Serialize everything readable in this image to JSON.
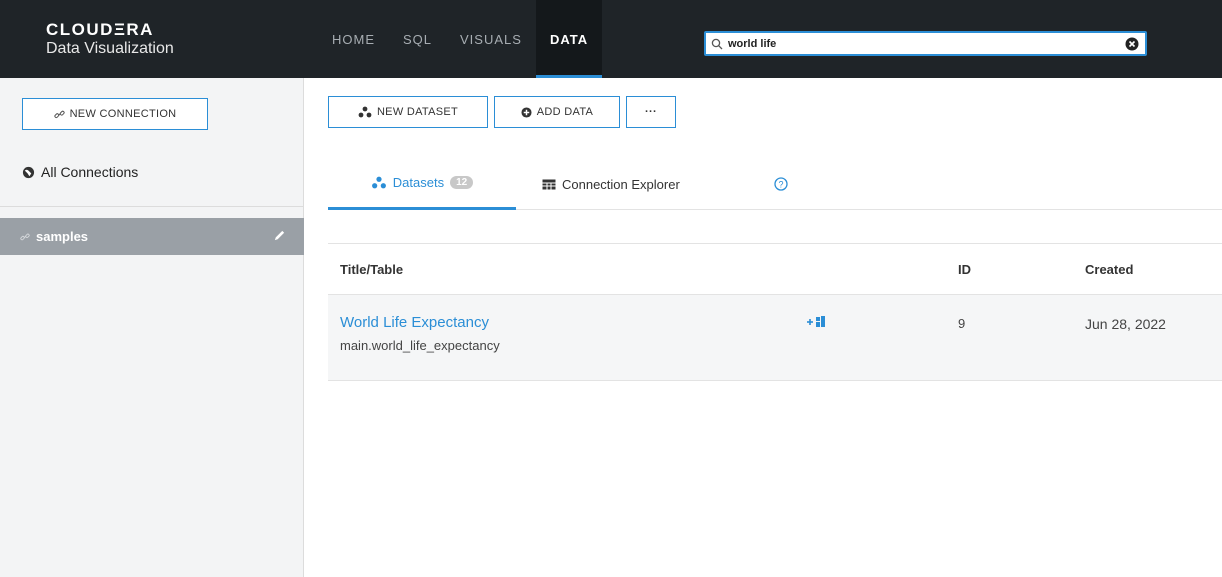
{
  "brand": {
    "name": "CLOUDΞRA",
    "product": "Data Visualization"
  },
  "nav": {
    "items": [
      "HOME",
      "SQL",
      "VISUALS",
      "DATA"
    ],
    "active": "DATA"
  },
  "search": {
    "value": "world life",
    "placeholder": ""
  },
  "sidebar": {
    "new_connection_label": "NEW CONNECTION",
    "all_connections_label": "All Connections",
    "connections": [
      {
        "label": "samples",
        "selected": true
      }
    ]
  },
  "toolbar": {
    "new_dataset_label": "NEW DATASET",
    "add_data_label": "ADD DATA",
    "more_label": "···"
  },
  "tabs": [
    {
      "label": "Datasets",
      "count": "12",
      "active": true
    },
    {
      "label": "Connection Explorer",
      "active": false
    }
  ],
  "table": {
    "headers": {
      "title": "Title/Table",
      "id": "ID",
      "created": "Created"
    },
    "rows": [
      {
        "title": "World Life Expectancy",
        "table": "main.world_life_expectancy",
        "id": "9",
        "created": "Jun 28, 2022"
      }
    ]
  },
  "colors": {
    "accent": "#2b8ed6",
    "topbar": "#1f2428",
    "sidebar": "#f3f4f5",
    "selected_connection": "#9aa0a6"
  }
}
